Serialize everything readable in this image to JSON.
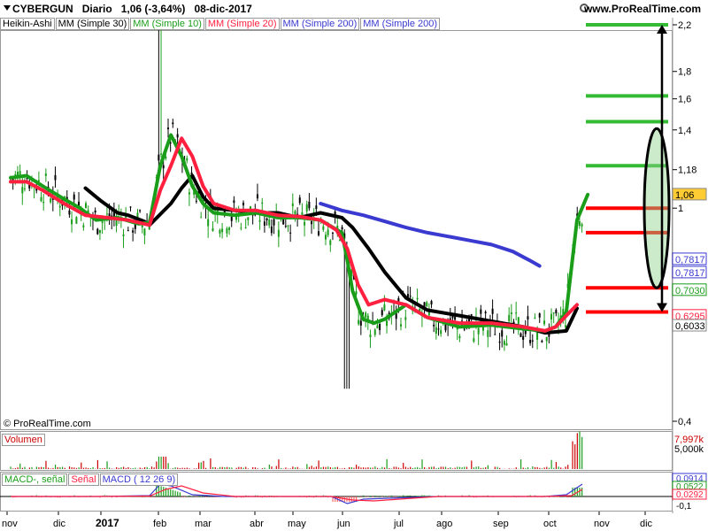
{
  "header": {
    "symbol": "CYBERGUN",
    "period": "Diario",
    "price": "1,06 (-3,64%)",
    "date": "08-dic-2017",
    "site": "www.ProRealTime.com"
  },
  "legend": [
    {
      "label": "Heikin-Ashi",
      "color": "#000000"
    },
    {
      "label": "MM (Simple 30)",
      "color": "#000000"
    },
    {
      "label": "MM (Simple 10)",
      "color": "#1a9e1a"
    },
    {
      "label": "MM (Simple 20)",
      "color": "#ff2040"
    },
    {
      "label": "MM (Simple 200)",
      "color": "#3a3ad0"
    },
    {
      "label": "MM (Simple 200)",
      "color": "#3a3ad0"
    }
  ],
  "credit": "© ProRealTime.com",
  "volume_label": "Volumen",
  "macd_labels": [
    {
      "label": "MACD-, señal",
      "color": "#1a9e1a"
    },
    {
      "label": "Señal",
      "color": "#ff2040"
    },
    {
      "label": "MACD ( 12 26 9)",
      "color": "#3a3ad0"
    }
  ],
  "price_axis": {
    "scale": "log",
    "ticks": [
      {
        "v": 2.2,
        "t": "2,2"
      },
      {
        "v": 1.8,
        "t": "1,8"
      },
      {
        "v": 1.6,
        "t": "1,6"
      },
      {
        "v": 1.4,
        "t": "1,4"
      },
      {
        "v": 1.18,
        "t": "1,18"
      },
      {
        "v": 1.0,
        "t": "1"
      },
      {
        "v": 0.4,
        "t": "0,4"
      }
    ],
    "tags": [
      {
        "v": 1.06,
        "t": "1,06",
        "bg": "#ffcc33",
        "fg": "#000000"
      },
      {
        "v": 0.7817,
        "t": "0,7817",
        "bg": "#ffffff",
        "fg": "#3a3ad0",
        "dy": -7
      },
      {
        "v": 0.7817,
        "t": "0,7817",
        "bg": "#ffffff",
        "fg": "#3a3ad0",
        "dy": 8
      },
      {
        "v": 0.703,
        "t": "0,7030",
        "bg": "#ffffff",
        "fg": "#1a9e1a"
      },
      {
        "v": 0.6295,
        "t": "0,6295",
        "bg": "#ffffff",
        "fg": "#ff2040"
      },
      {
        "v": 0.6033,
        "t": "0,6033",
        "bg": "#ffffff",
        "fg": "#000000"
      }
    ]
  },
  "volume_axis": [
    {
      "t": "7,997k",
      "color": "#cc0000"
    },
    {
      "t": "5,000k",
      "color": "#000000"
    }
  ],
  "macd_axis": [
    {
      "t": "0,0914",
      "color": "#3a3ad0"
    },
    {
      "t": "0,0522",
      "color": "#1a9e1a"
    },
    {
      "t": "0,0292",
      "color": "#ff2040"
    },
    {
      "t": "-0,1",
      "color": "#000000"
    }
  ],
  "chart_data": {
    "type": "line",
    "title": "CYBERGUN Diario",
    "x_labels": [
      "nov",
      "dic",
      "2017",
      "feb",
      "mar",
      "abr",
      "may",
      "jun",
      "jul",
      "ago",
      "sep",
      "oct",
      "nov",
      "dic"
    ],
    "ylim": [
      0.4,
      2.2
    ],
    "levels_green": [
      2.2,
      1.62,
      1.45,
      1.2
    ],
    "levels_red": [
      1.0,
      0.9,
      0.71,
      0.64
    ],
    "series": [
      {
        "name": "MM (Simple 30)",
        "color": "#000000",
        "points": [
          [
            7,
            1.09
          ],
          [
            8.5,
            1.03
          ],
          [
            10,
            0.98
          ],
          [
            11,
            0.97
          ],
          [
            12.5,
            0.945
          ],
          [
            13,
            0.93
          ],
          [
            15,
            1.02
          ],
          [
            16,
            1.09
          ],
          [
            17,
            1.15
          ],
          [
            18,
            1.05
          ],
          [
            19,
            1.0
          ],
          [
            21,
            0.99
          ],
          [
            23,
            0.98
          ],
          [
            25,
            0.98
          ],
          [
            27,
            0.96
          ],
          [
            29,
            0.98
          ],
          [
            31,
            0.96
          ],
          [
            32,
            0.92
          ],
          [
            33.5,
            0.84
          ],
          [
            35,
            0.76
          ],
          [
            37,
            0.68
          ],
          [
            39,
            0.645
          ],
          [
            42,
            0.63
          ],
          [
            45,
            0.615
          ],
          [
            48,
            0.6
          ],
          [
            50,
            0.585
          ],
          [
            52,
            0.59
          ],
          [
            53,
            0.65
          ]
        ]
      },
      {
        "name": "MM (Simple 10)",
        "color": "#1a9e1a",
        "points": [
          [
            0,
            1.14
          ],
          [
            1.5,
            1.15
          ],
          [
            3,
            1.1
          ],
          [
            5,
            1.04
          ],
          [
            6.5,
            1.0
          ],
          [
            8,
            0.95
          ],
          [
            10,
            0.96
          ],
          [
            12,
            0.935
          ],
          [
            13,
            0.94
          ],
          [
            14,
            1.2
          ],
          [
            15,
            1.37
          ],
          [
            16,
            1.25
          ],
          [
            17,
            1.1
          ],
          [
            18,
            1.02
          ],
          [
            19,
            0.98
          ],
          [
            21,
            0.97
          ],
          [
            23,
            0.98
          ],
          [
            25,
            0.96
          ],
          [
            27,
            0.96
          ],
          [
            29,
            0.95
          ],
          [
            31,
            0.9
          ],
          [
            31.5,
            0.8
          ],
          [
            32,
            0.7
          ],
          [
            33,
            0.62
          ],
          [
            34,
            0.61
          ],
          [
            35,
            0.62
          ],
          [
            37,
            0.66
          ],
          [
            39,
            0.625
          ],
          [
            42,
            0.6
          ],
          [
            45,
            0.605
          ],
          [
            48,
            0.595
          ],
          [
            50,
            0.59
          ],
          [
            51,
            0.6
          ],
          [
            52,
            0.64
          ],
          [
            53,
            0.95
          ],
          [
            54,
            1.06
          ]
        ]
      },
      {
        "name": "MM (Simple 20)",
        "color": "#ff2040",
        "points": [
          [
            0,
            1.12
          ],
          [
            1.5,
            1.12
          ],
          [
            3,
            1.08
          ],
          [
            5,
            1.02
          ],
          [
            7,
            0.97
          ],
          [
            9,
            0.96
          ],
          [
            11,
            0.95
          ],
          [
            13,
            0.93
          ],
          [
            14,
            1.08
          ],
          [
            15,
            1.2
          ],
          [
            16,
            1.35
          ],
          [
            17,
            1.25
          ],
          [
            18,
            1.1
          ],
          [
            19,
            1.02
          ],
          [
            21,
            0.99
          ],
          [
            23,
            0.99
          ],
          [
            25,
            0.97
          ],
          [
            27,
            0.965
          ],
          [
            29,
            0.95
          ],
          [
            30.5,
            0.91
          ],
          [
            31.5,
            0.84
          ],
          [
            32.5,
            0.72
          ],
          [
            33.5,
            0.66
          ],
          [
            35,
            0.675
          ],
          [
            37,
            0.66
          ],
          [
            39,
            0.625
          ],
          [
            42,
            0.61
          ],
          [
            45,
            0.61
          ],
          [
            48,
            0.6
          ],
          [
            50,
            0.59
          ],
          [
            51,
            0.6
          ],
          [
            52,
            0.63
          ],
          [
            53,
            0.66
          ]
        ]
      },
      {
        "name": "MM (Simple 200)",
        "color": "#3a3ad0",
        "points": [
          [
            29,
            1.02
          ],
          [
            31,
            0.99
          ],
          [
            33,
            0.97
          ],
          [
            35,
            0.945
          ],
          [
            37,
            0.92
          ],
          [
            39,
            0.9
          ],
          [
            41,
            0.885
          ],
          [
            43,
            0.87
          ],
          [
            45,
            0.855
          ],
          [
            47,
            0.83
          ],
          [
            48.5,
            0.8
          ],
          [
            49.5,
            0.78
          ]
        ]
      }
    ]
  }
}
